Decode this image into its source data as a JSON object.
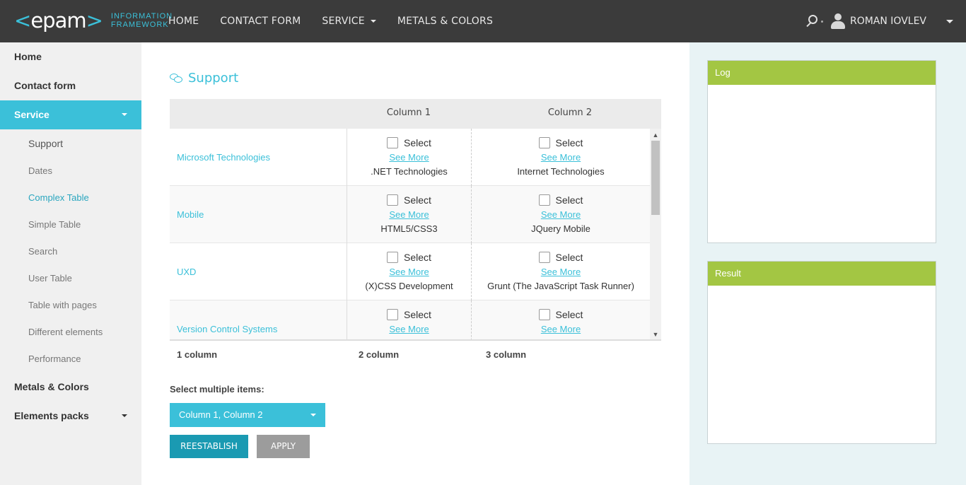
{
  "header": {
    "logo_text": "epam",
    "logo_sub_line1": "INFORMATION",
    "logo_sub_line2": "FRAMEWORK",
    "nav": [
      {
        "label": "HOME"
      },
      {
        "label": "CONTACT FORM"
      },
      {
        "label": "SERVICE",
        "has_dropdown": true
      },
      {
        "label": "METALS & COLORS"
      }
    ],
    "user_name": "ROMAN IOVLEV"
  },
  "sidebar": {
    "items": [
      {
        "label": "Home"
      },
      {
        "label": "Contact form"
      },
      {
        "label": "Service",
        "active": true
      },
      {
        "label": "Metals & Colors"
      },
      {
        "label": "Elements packs"
      }
    ],
    "service_sub": [
      {
        "label": "Support"
      },
      {
        "label": "Dates"
      },
      {
        "label": "Complex Table",
        "active": true
      },
      {
        "label": "Simple Table"
      },
      {
        "label": "Search"
      },
      {
        "label": "User Table"
      },
      {
        "label": "Table with pages"
      },
      {
        "label": "Different elements"
      },
      {
        "label": "Performance"
      }
    ]
  },
  "main": {
    "title": "Support",
    "table": {
      "headers": [
        "",
        "Column 1",
        "Column 2"
      ],
      "select_label": "Select",
      "see_more_label": "See More",
      "rows": [
        {
          "label": "Microsoft Technologies",
          "col1": ".NET Technologies",
          "col2": "Internet Technologies"
        },
        {
          "label": "Mobile",
          "col1": "HTML5/CSS3",
          "col2": "JQuery Mobile"
        },
        {
          "label": "UXD",
          "col1": "(X)CSS Development",
          "col2": "Grunt (The JavaScript Task Runner)"
        },
        {
          "label": "Version Control Systems",
          "col1": "",
          "col2": ""
        }
      ],
      "footer": [
        "1 column",
        "2 column",
        "3 column"
      ]
    },
    "multi_select_label": "Select multiple items:",
    "multi_select_value": "Column 1, Column 2",
    "reestablish_label": "REESTABLISH",
    "apply_label": "APPLY"
  },
  "right": {
    "log_title": "Log",
    "result_title": "Result"
  },
  "colors": {
    "accent": "#3bc0d9",
    "panel_header": "#a3c643",
    "header_bg": "#3b3b3b"
  }
}
